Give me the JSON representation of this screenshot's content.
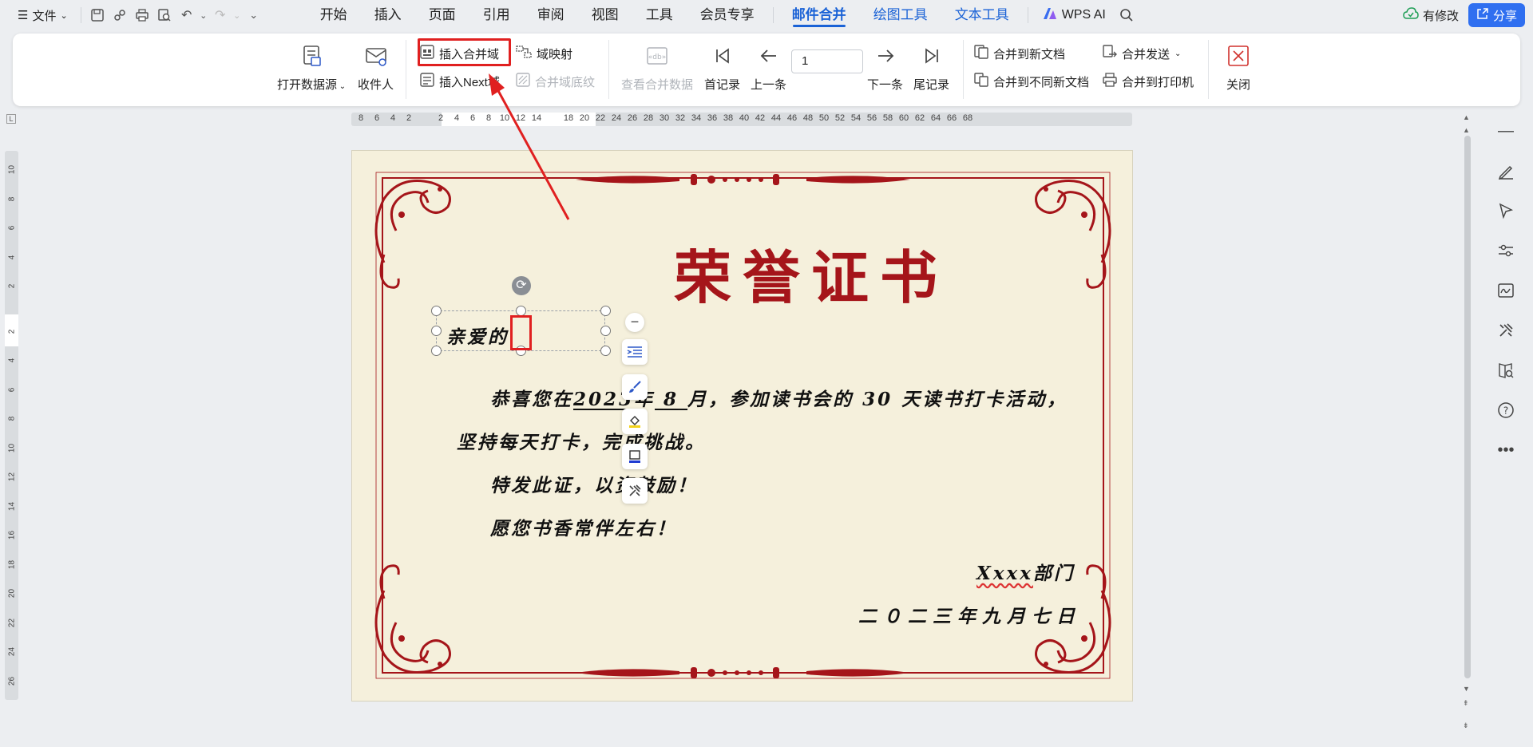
{
  "menubar": {
    "menu_icon": "hamburger-icon",
    "file_label": "文件",
    "tabs": [
      "开始",
      "插入",
      "页面",
      "引用",
      "审阅",
      "视图",
      "工具",
      "会员专享",
      "邮件合并",
      "绘图工具",
      "文本工具"
    ],
    "active_tab": "邮件合并",
    "wps_ai_label": "WPS AI",
    "modify_label": "有修改",
    "share_label": "分享",
    "accent_color": "#1a62d6"
  },
  "ribbon": {
    "open_datasource": "打开数据源",
    "recipients": "收件人",
    "insert_merge_field": "插入合并域",
    "field_mapping": "域映射",
    "insert_next_field": "插入Next域",
    "merge_field_shading": "合并域底纹",
    "view_merge_data": "查看合并数据",
    "first_record": "首记录",
    "prev_record": "上一条",
    "record_number": "1",
    "next_record": "下一条",
    "last_record": "尾记录",
    "merge_new_doc": "合并到新文档",
    "merge_send": "合并发送",
    "merge_diff_docs": "合并到不同新文档",
    "merge_printer": "合并到打印机",
    "close": "关闭"
  },
  "ruler": {
    "h_ticks": [
      "8",
      "6",
      "4",
      "2",
      "",
      "2",
      "4",
      "6",
      "8",
      "10",
      "12",
      "14",
      "",
      "18",
      "20",
      "22",
      "24",
      "26",
      "28",
      "30",
      "32",
      "34",
      "36",
      "38",
      "40",
      "42",
      "44",
      "46",
      "48",
      "50",
      "52",
      "54",
      "56",
      "58",
      "60",
      "62",
      "64",
      "66",
      "68"
    ],
    "v_ticks": [
      "10",
      "8",
      "6",
      "4",
      "2",
      "2",
      "4",
      "6",
      "8",
      "10",
      "12",
      "14",
      "16",
      "18",
      "20",
      "22",
      "24",
      "26"
    ]
  },
  "certificate": {
    "title": "荣誉证书",
    "salutation": "亲爱的",
    "line1_a": "恭喜您在",
    "line1_year": "2023",
    "line1_b": "年",
    "line1_month": "8",
    "line1_c": "月，参加读书会的 30 天读书打卡活动，",
    "line2": "坚持每天打卡，完成挑战。",
    "line3": "特发此证，以资鼓励！",
    "line4": "愿您书香常伴左右！",
    "dept_name": "Xxxx",
    "dept_suffix": "部门",
    "date": "二０二三年九月七日",
    "title_color": "#a5151a",
    "paper_color": "#f5f0dc"
  },
  "float_toolbar": [
    "layout-options-icon",
    "brush-icon",
    "fill-icon",
    "border-icon",
    "tools-icon"
  ],
  "sidebar_icons": [
    "collapse-icon",
    "pen-icon",
    "select-icon",
    "settings-sliders-icon",
    "signature-icon",
    "tools-icon",
    "book-search-icon",
    "help-icon",
    "more-icon"
  ]
}
